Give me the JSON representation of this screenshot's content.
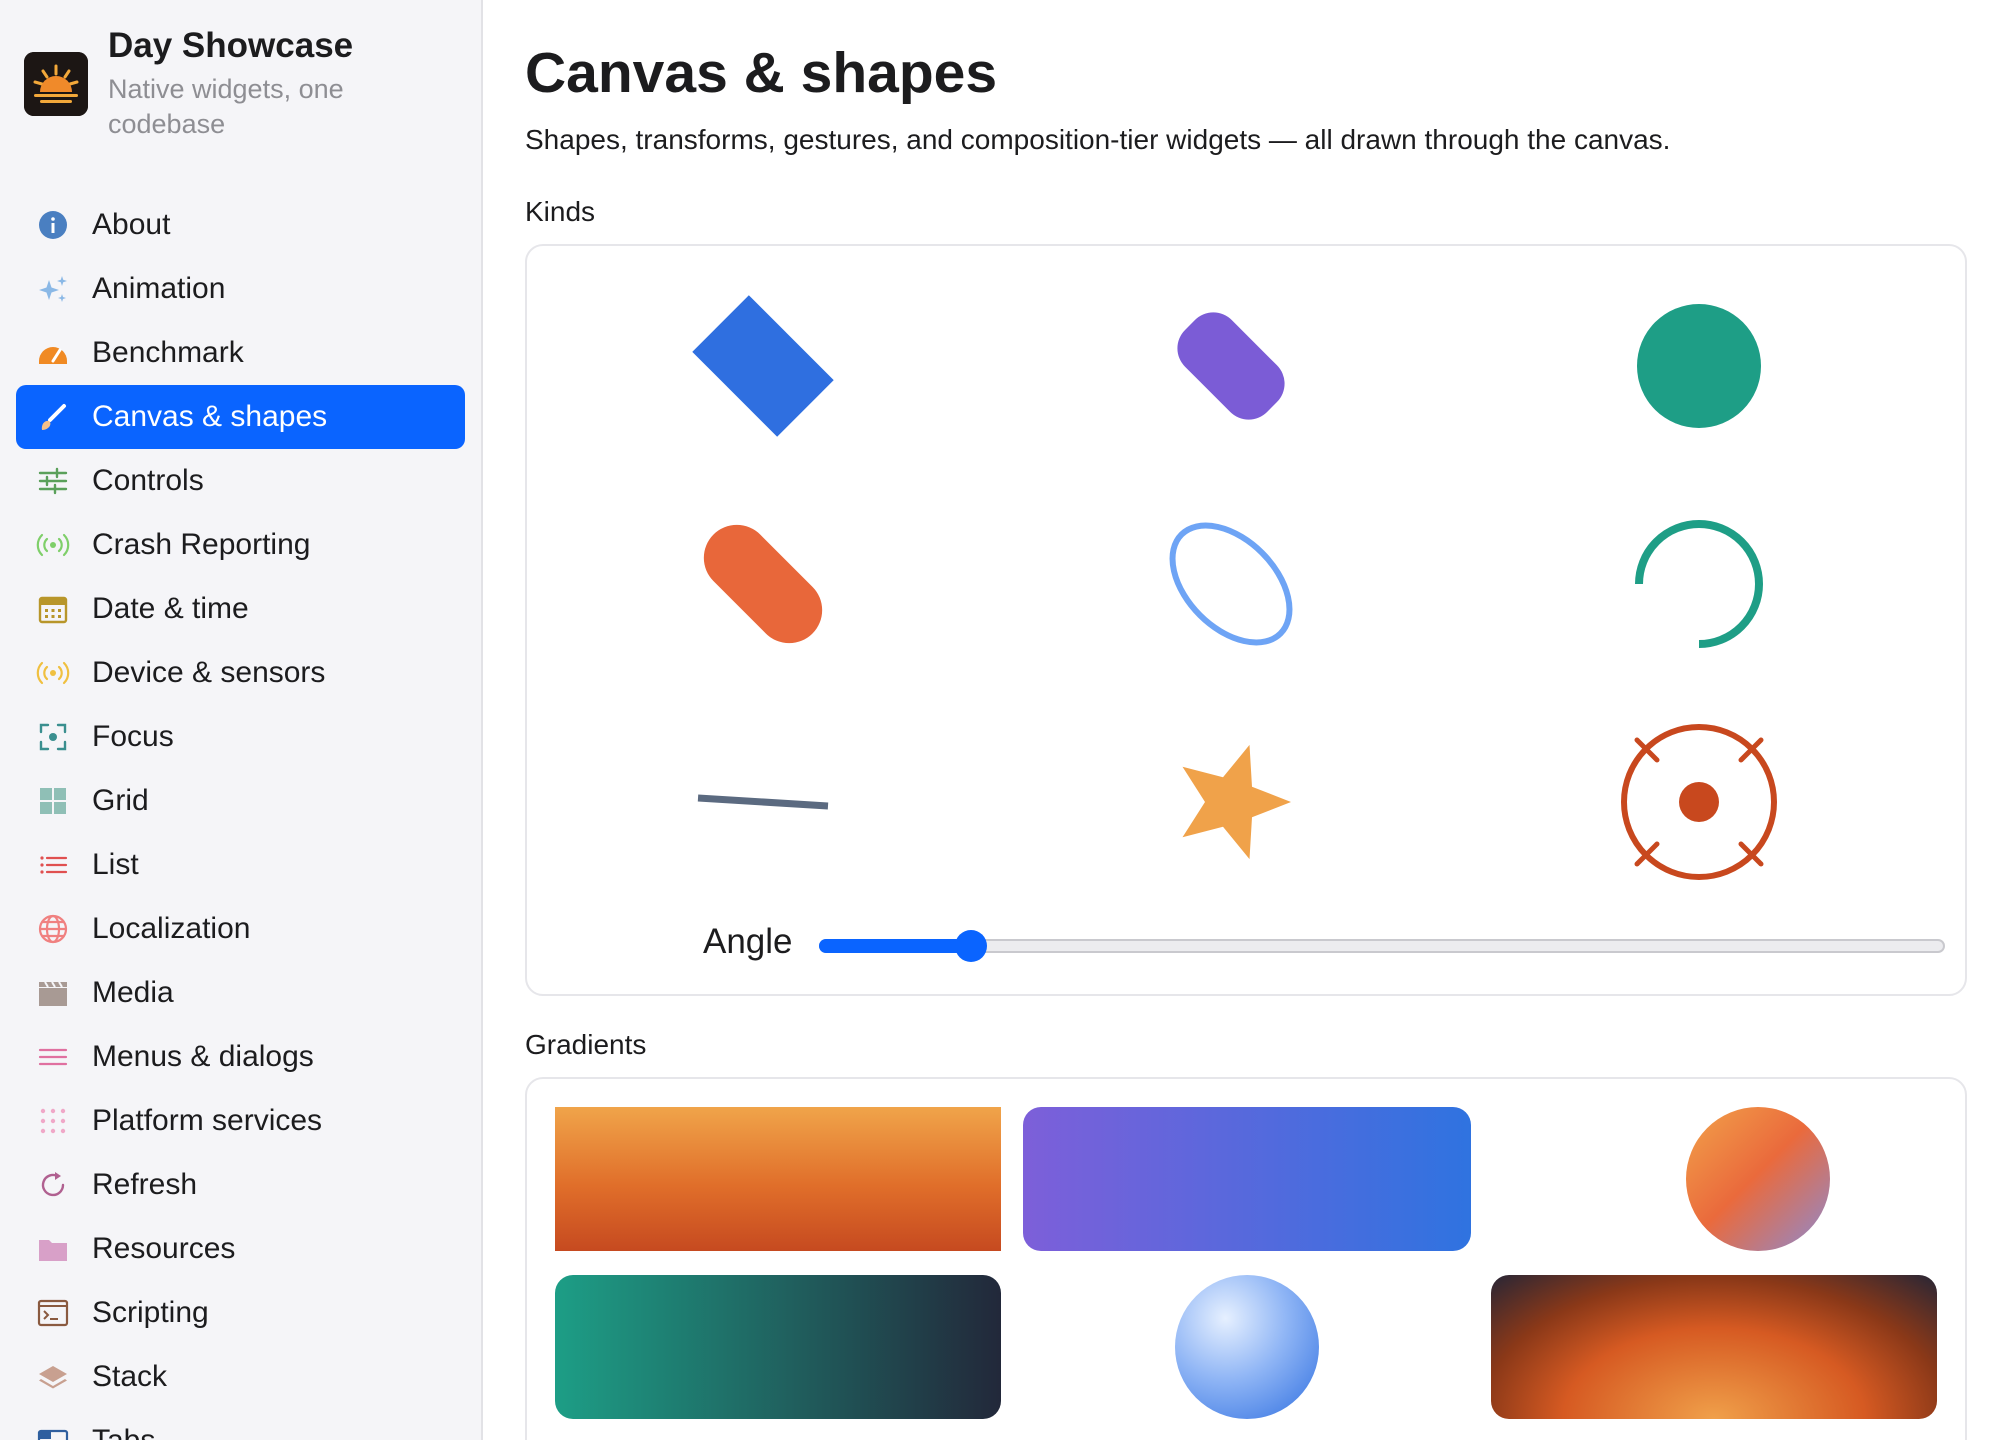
{
  "app": {
    "title": "Day Showcase",
    "subtitle": "Native widgets, one codebase"
  },
  "sidebar": {
    "items": [
      {
        "label": "About",
        "icon": "info-icon",
        "color": "#4a7fc1"
      },
      {
        "label": "Animation",
        "icon": "sparkles-icon",
        "color": "#8ab8e6"
      },
      {
        "label": "Benchmark",
        "icon": "gauge-icon",
        "color": "#f08a24"
      },
      {
        "label": "Canvas & shapes",
        "icon": "paintbrush-icon",
        "color": "#f5c08a",
        "active": true
      },
      {
        "label": "Controls",
        "icon": "sliders-icon",
        "color": "#5aa05a"
      },
      {
        "label": "Crash Reporting",
        "icon": "broadcast-icon",
        "color": "#7fcf6a"
      },
      {
        "label": "Date & time",
        "icon": "calendar-icon",
        "color": "#b8962a"
      },
      {
        "label": "Device & sensors",
        "icon": "broadcast-icon",
        "color": "#f0c040"
      },
      {
        "label": "Focus",
        "icon": "focus-icon",
        "color": "#3a8f8f"
      },
      {
        "label": "Grid",
        "icon": "grid-icon",
        "color": "#8fbfb6"
      },
      {
        "label": "List",
        "icon": "list-icon",
        "color": "#e05050"
      },
      {
        "label": "Localization",
        "icon": "globe-icon",
        "color": "#f08080"
      },
      {
        "label": "Media",
        "icon": "clapperboard-icon",
        "color": "#a89a94"
      },
      {
        "label": "Menus & dialogs",
        "icon": "menu-icon",
        "color": "#e070a0"
      },
      {
        "label": "Platform services",
        "icon": "dots-grid-icon",
        "color": "#f0a8c8"
      },
      {
        "label": "Refresh",
        "icon": "refresh-icon",
        "color": "#b06090"
      },
      {
        "label": "Resources",
        "icon": "folder-icon",
        "color": "#d8a0c8"
      },
      {
        "label": "Scripting",
        "icon": "terminal-icon",
        "color": "#8a5a40"
      },
      {
        "label": "Stack",
        "icon": "layers-icon",
        "color": "#c8a090"
      },
      {
        "label": "Tabs",
        "icon": "tabs-icon",
        "color": "#2f5f9f"
      }
    ]
  },
  "main": {
    "title": "Canvas & shapes",
    "description": "Shapes, transforms, gestures, and composition-tier widgets — all drawn through the canvas.",
    "kinds_label": "Kinds",
    "gradients_label": "Gradients",
    "angle_label": "Angle",
    "angle_fraction": 0.135,
    "shapes": [
      {
        "kind": "rectangle",
        "color": "#2f6fe0"
      },
      {
        "kind": "rounded-rectangle",
        "color": "#7b5cd6"
      },
      {
        "kind": "circle",
        "color": "#1e9e86"
      },
      {
        "kind": "capsule",
        "color": "#e8673a"
      },
      {
        "kind": "ellipse-outline",
        "color": "#6ea4f5"
      },
      {
        "kind": "arc",
        "color": "#1e9e86"
      },
      {
        "kind": "line",
        "color": "#5b6a80"
      },
      {
        "kind": "star",
        "color": "#f0a24a"
      },
      {
        "kind": "target",
        "color": "#c8481e"
      }
    ],
    "gradients": [
      {
        "kind": "linear-vertical-orange"
      },
      {
        "kind": "linear-horizontal-purple-blue"
      },
      {
        "kind": "linear-diagonal-circle"
      },
      {
        "kind": "linear-horizontal-teal-navy"
      },
      {
        "kind": "radial-blue-sphere"
      },
      {
        "kind": "radial-sunset"
      }
    ]
  }
}
